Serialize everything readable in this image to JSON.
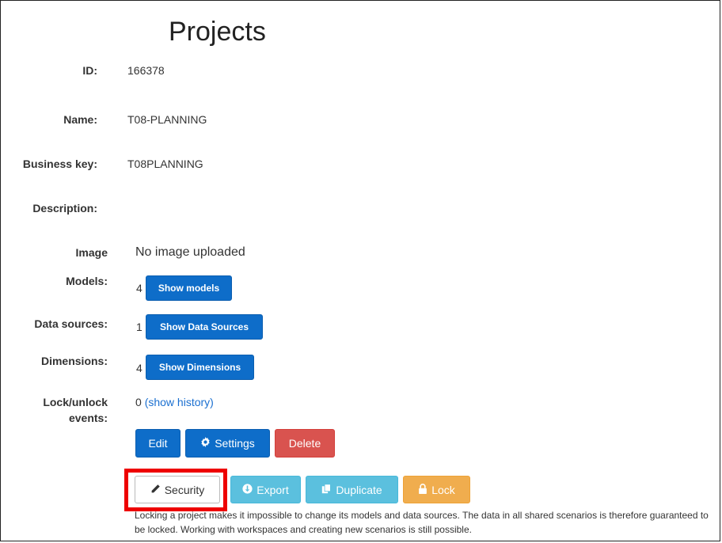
{
  "page": {
    "title": "Projects"
  },
  "fields": {
    "id": {
      "label": "ID:",
      "value": "166378"
    },
    "name": {
      "label": "Name:",
      "value": "T08-PLANNING"
    },
    "business_key": {
      "label": "Business key:",
      "value": "T08PLANNING"
    },
    "description": {
      "label": "Description:",
      "value": ""
    },
    "image": {
      "label": "Image",
      "value": "No image uploaded"
    },
    "models": {
      "label": "Models:",
      "count": "4",
      "button": "Show models"
    },
    "data_sources": {
      "label": "Data sources:",
      "count": "1",
      "button": "Show Data Sources"
    },
    "dimensions": {
      "label": "Dimensions:",
      "count": "4",
      "button": "Show Dimensions"
    },
    "lock_events": {
      "label_line1": "Lock/unlock",
      "label_line2": "events:",
      "count": "0",
      "link": "(show history)"
    }
  },
  "actions": {
    "edit": "Edit",
    "settings": "Settings",
    "delete": "Delete",
    "security": "Security",
    "export": "Export",
    "duplicate": "Duplicate",
    "lock": "Lock"
  },
  "lock_note": "Locking a project makes it impossible to change its models and data sources. The data in all shared scenarios is therefore guaranteed to be locked. Working with workspaces and creating new scenarios is still possible.",
  "colors": {
    "primary": "#0e6dc9",
    "danger": "#d9534f",
    "info": "#5bc0de",
    "warning": "#f0ad4e",
    "highlight": "#ee0000"
  }
}
